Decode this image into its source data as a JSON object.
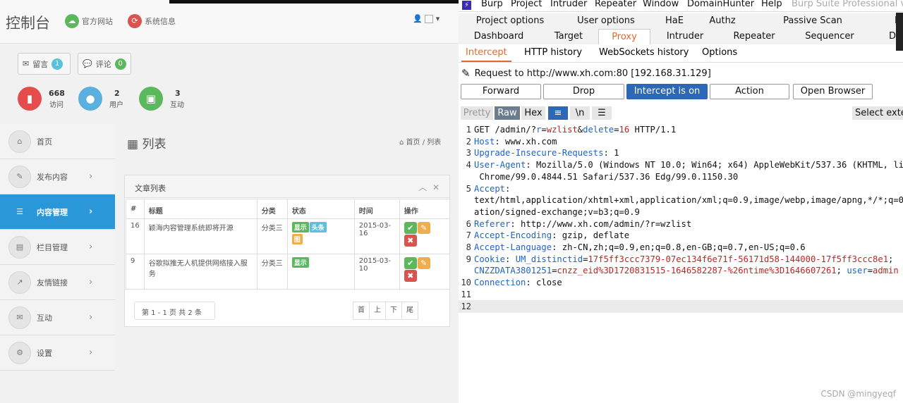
{
  "left": {
    "brand": "控制台",
    "top_links": [
      {
        "label": "官方网站",
        "color": "#5cb85c"
      },
      {
        "label": "系统信息",
        "color": "#d9534f"
      }
    ],
    "user_icon": "user-icon",
    "stat_buttons": [
      {
        "label": "留言",
        "count": "1",
        "color": "#5bc0de"
      },
      {
        "label": "评论",
        "count": "0",
        "color": "#5cb85c"
      }
    ],
    "stats": [
      {
        "value": "668",
        "label": "访问",
        "color": "#e74c4c"
      },
      {
        "value": "2",
        "label": "用户",
        "color": "#5bb0df"
      },
      {
        "value": "3",
        "label": "互动",
        "color": "#5cb85c"
      }
    ],
    "sidebar": [
      {
        "label": "首页",
        "icon": "home-icon",
        "arrow": false,
        "active": false
      },
      {
        "label": "发布内容",
        "icon": "pencil-icon",
        "arrow": true,
        "active": false
      },
      {
        "label": "内容管理",
        "icon": "list-icon",
        "arrow": true,
        "active": true
      },
      {
        "label": "栏目管理",
        "icon": "columns-icon",
        "arrow": true,
        "active": false
      },
      {
        "label": "友情链接",
        "icon": "link-icon",
        "arrow": true,
        "active": false
      },
      {
        "label": "互动",
        "icon": "chat-icon",
        "arrow": true,
        "active": false
      },
      {
        "label": "设置",
        "icon": "gear-icon",
        "arrow": true,
        "active": false
      }
    ],
    "page_title": "列表",
    "breadcrumb": {
      "home": "首页",
      "sep": "/",
      "current": "列表"
    },
    "panel_title": "文章列表",
    "table": {
      "headers": [
        "#",
        "标题",
        "分类",
        "状态",
        "时间",
        "操作"
      ],
      "rows": [
        {
          "id": "16",
          "title": "颖海内容管理系统即将开源",
          "category": "分类三",
          "tags": [
            "显示",
            "头条",
            "图"
          ],
          "date": "2015-03-16"
        },
        {
          "id": "9",
          "title": "谷歌拟推无人机提供网络接入服务",
          "category": "分类三",
          "tags": [
            "显示"
          ],
          "date": "2015-03-10"
        }
      ]
    },
    "pagination_info": "第 1 - 1 页 共 2 条",
    "pager": [
      "首",
      "上",
      "下",
      "尾"
    ]
  },
  "burp": {
    "menu": [
      "Burp",
      "Project",
      "Intruder",
      "Repeater",
      "Window",
      "DomainHunter",
      "Help",
      "Burp Suite Professional v2"
    ],
    "tabs_row1": [
      "Project options",
      "User options",
      "HaE",
      "Authz",
      "Passive Scan Client",
      "Bu"
    ],
    "tabs_row2": [
      "Dashboard",
      "Target",
      "Proxy",
      "Intruder",
      "Repeater",
      "Sequencer",
      "De"
    ],
    "subtabs": [
      "Intercept",
      "HTTP history",
      "WebSockets history",
      "Options"
    ],
    "request_line": "Request to http://www.xh.com:80  [192.168.31.129]",
    "buttons": [
      "Forward",
      "Drop",
      "Intercept is on",
      "Action",
      "Open Browser"
    ],
    "view_modes": [
      "Pretty",
      "Raw",
      "Hex"
    ],
    "view_icons": [
      "wrap-icon",
      "newline-icon",
      "menu-icon"
    ],
    "newline_glyph": "\\n",
    "select_ext": "Select exte",
    "accent": "#e8662e",
    "blue": "#2c68b5",
    "code_lines": [
      {
        "n": "1",
        "parts": [
          [
            "GET /admin/?",
            "t"
          ],
          [
            "r",
            "k"
          ],
          [
            "=",
            "t"
          ],
          [
            "wzlist",
            "v"
          ],
          [
            "&",
            "t"
          ],
          [
            "delete",
            "k"
          ],
          [
            "=",
            "t"
          ],
          [
            "16",
            "v"
          ],
          [
            " HTTP/1.1",
            "t"
          ]
        ]
      },
      {
        "n": "2",
        "parts": [
          [
            "Host",
            "k"
          ],
          [
            ": www.xh.com",
            "t"
          ]
        ]
      },
      {
        "n": "3",
        "parts": [
          [
            "Upgrade-Insecure-Requests",
            "k"
          ],
          [
            ": 1",
            "t"
          ]
        ]
      },
      {
        "n": "4",
        "parts": [
          [
            "User-Agent",
            "k"
          ],
          [
            ": Mozilla/5.0 (Windows NT 10.0; Win64; x64) AppleWebKit/537.36 (KHTML, li",
            "t"
          ]
        ]
      },
      {
        "n": "",
        "parts": [
          [
            " Chrome/99.0.4844.51 Safari/537.36 Edg/99.0.1150.30",
            "t"
          ]
        ]
      },
      {
        "n": "5",
        "parts": [
          [
            "Accept",
            "k"
          ],
          [
            ":",
            "t"
          ]
        ]
      },
      {
        "n": "",
        "parts": [
          [
            "text/html,application/xhtml+xml,application/xml;q=0.9,image/webp,image/apng,*/*;q=0",
            "t"
          ]
        ]
      },
      {
        "n": "",
        "parts": [
          [
            "ation/signed-exchange;v=b3;q=0.9",
            "t"
          ]
        ]
      },
      {
        "n": "6",
        "parts": [
          [
            "Referer",
            "k"
          ],
          [
            ": http://www.xh.com/admin/?r=wzlist",
            "t"
          ]
        ]
      },
      {
        "n": "7",
        "parts": [
          [
            "Accept-Encoding",
            "k"
          ],
          [
            ": gzip, deflate",
            "t"
          ]
        ]
      },
      {
        "n": "8",
        "parts": [
          [
            "Accept-Language",
            "k"
          ],
          [
            ": zh-CN,zh;q=0.9,en;q=0.8,en-GB;q=0.7,en-US;q=0.6",
            "t"
          ]
        ]
      },
      {
        "n": "9",
        "parts": [
          [
            "Cookie",
            "k"
          ],
          [
            ": ",
            "t"
          ],
          [
            "UM_distinctid",
            "k"
          ],
          [
            "=",
            "t"
          ],
          [
            "17f5ff3ccc7379-07ec134f6e71f-56171d58-144000-17f5ff3ccc8e1",
            "v"
          ],
          [
            ";",
            "t"
          ]
        ]
      },
      {
        "n": "",
        "parts": [
          [
            "CNZZDATA3801251",
            "k"
          ],
          [
            "=",
            "t"
          ],
          [
            "cnzz_eid%3D1720831515-1646582287-%26ntime%3D1646607261",
            "v"
          ],
          [
            "; ",
            "t"
          ],
          [
            "user",
            "k"
          ],
          [
            "=",
            "t"
          ],
          [
            "admin",
            "v"
          ]
        ]
      },
      {
        "n": "10",
        "parts": [
          [
            "Connection",
            "k"
          ],
          [
            ": close",
            "t"
          ]
        ]
      },
      {
        "n": "11",
        "parts": []
      },
      {
        "n": "12",
        "parts": []
      }
    ],
    "watermark": "CSDN @mingyeqf"
  }
}
